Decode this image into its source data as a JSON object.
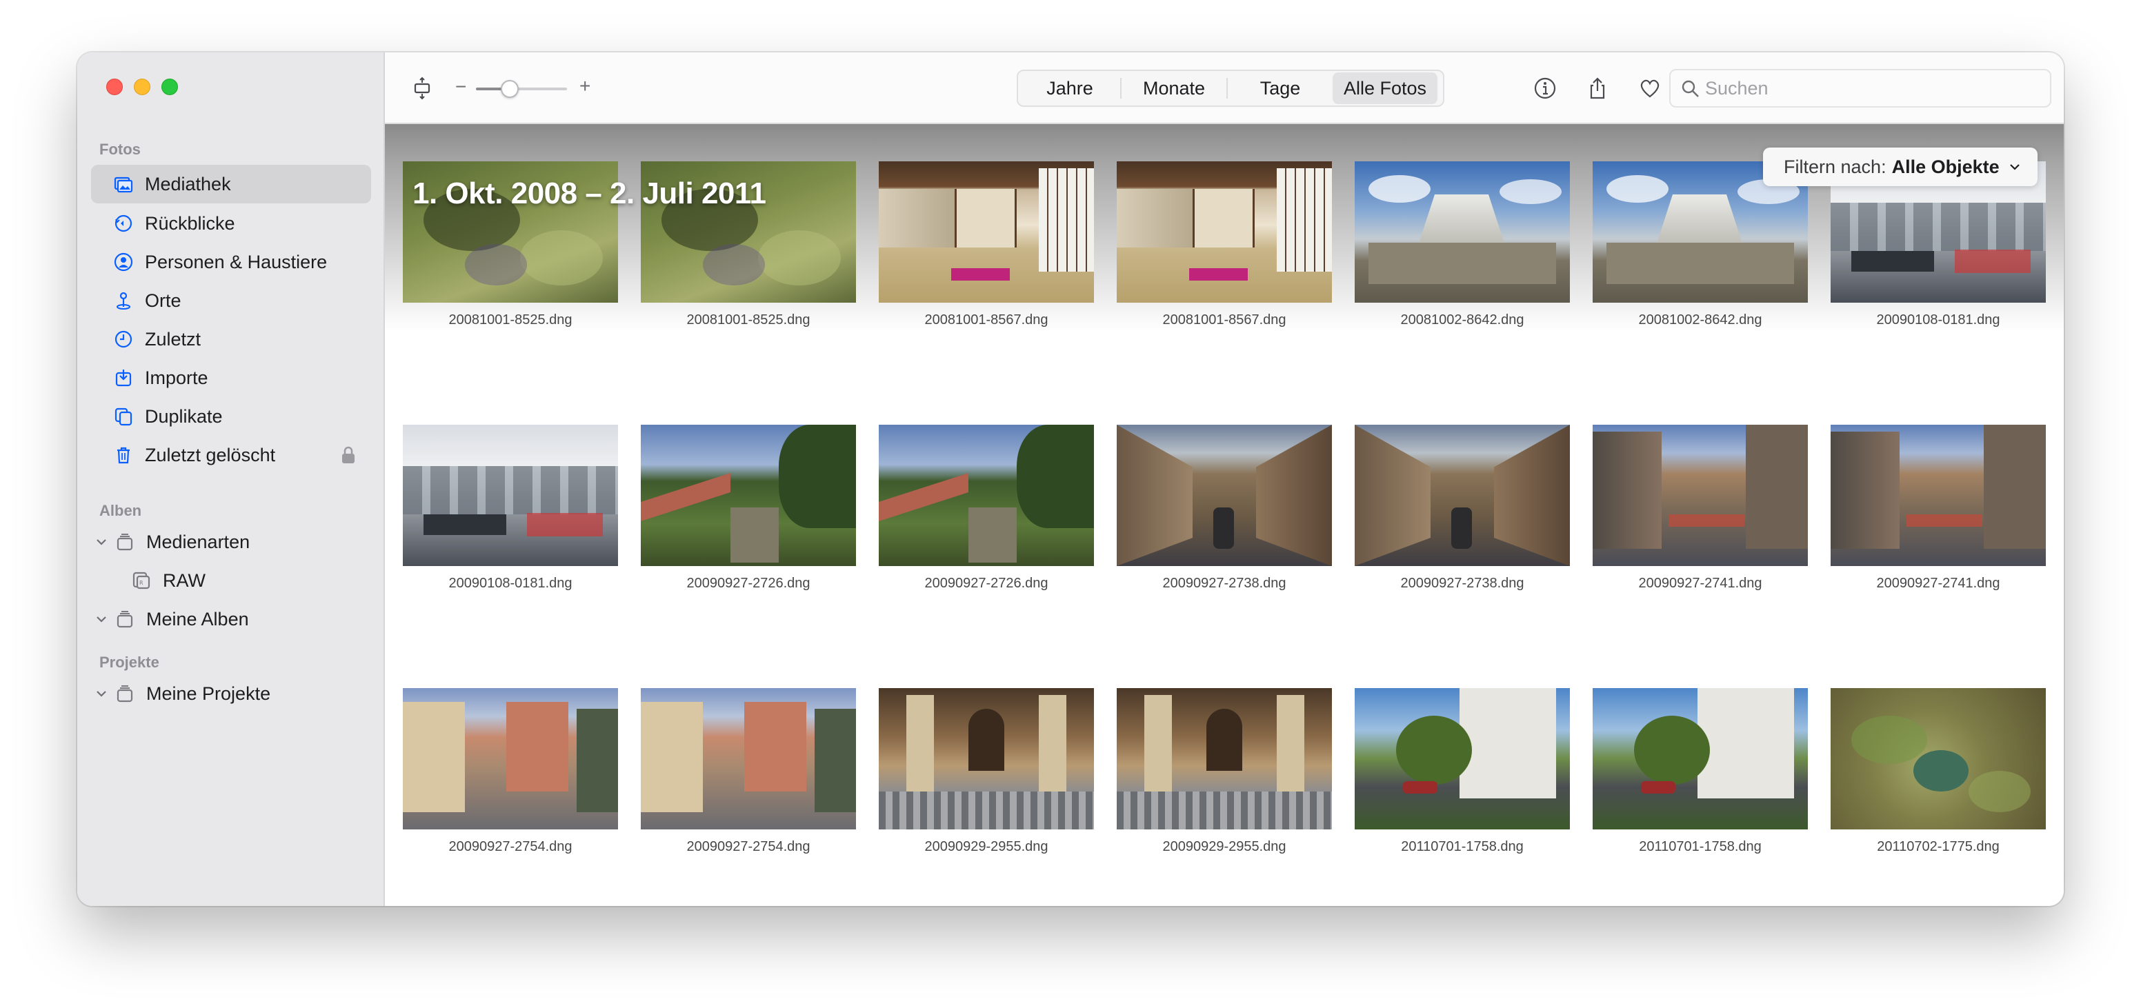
{
  "sidebar": {
    "sections": [
      {
        "label": "Fotos"
      },
      {
        "label": "Alben"
      },
      {
        "label": "Projekte"
      }
    ],
    "items": [
      {
        "label": "Mediathek",
        "icon": "library-icon",
        "selected": true
      },
      {
        "label": "Rückblicke",
        "icon": "memories-icon"
      },
      {
        "label": "Personen & Haustiere",
        "icon": "people-icon"
      },
      {
        "label": "Orte",
        "icon": "places-icon"
      },
      {
        "label": "Zuletzt",
        "icon": "recents-icon"
      },
      {
        "label": "Importe",
        "icon": "imports-icon"
      },
      {
        "label": "Duplikate",
        "icon": "duplicates-icon"
      },
      {
        "label": "Zuletzt gelöscht",
        "icon": "trash-icon",
        "locked": true
      },
      {
        "label": "Medienarten",
        "icon": "folder-stack-icon",
        "expanded": true
      },
      {
        "label": "RAW",
        "icon": "raw-icon"
      },
      {
        "label": "Meine Alben",
        "icon": "folder-stack-icon",
        "expanded": true
      },
      {
        "label": "Meine Projekte",
        "icon": "folder-stack-icon",
        "expanded": true
      }
    ]
  },
  "toolbar": {
    "zoom_minus": "−",
    "zoom_plus": "+",
    "zoom_level": 0.35,
    "segments": [
      "Jahre",
      "Monate",
      "Tage",
      "Alle Fotos"
    ],
    "active_segment": "Alle Fotos",
    "search_placeholder": "Suchen"
  },
  "content": {
    "date_range": "1. Okt. 2008 – 2. Juli 2011",
    "filter_label": "Filtern nach:",
    "filter_value": "Alle Objekte",
    "photos": [
      {
        "name": "20081001-8525.dng",
        "scene": "garden"
      },
      {
        "name": "20081001-8525.dng",
        "scene": "garden"
      },
      {
        "name": "20081001-8567.dng",
        "scene": "tatami"
      },
      {
        "name": "20081001-8567.dng",
        "scene": "tatami"
      },
      {
        "name": "20081002-8642.dng",
        "scene": "castle"
      },
      {
        "name": "20081002-8642.dng",
        "scene": "castle"
      },
      {
        "name": "20090108-0181.dng",
        "scene": "office"
      },
      {
        "name": "20090108-0181.dng",
        "scene": "office"
      },
      {
        "name": "20090927-2726.dng",
        "scene": "cloister"
      },
      {
        "name": "20090927-2726.dng",
        "scene": "cloister"
      },
      {
        "name": "20090927-2738.dng",
        "scene": "alley"
      },
      {
        "name": "20090927-2738.dng",
        "scene": "alley"
      },
      {
        "name": "20090927-2741.dng",
        "scene": "street"
      },
      {
        "name": "20090927-2741.dng",
        "scene": "street"
      },
      {
        "name": "20090927-2754.dng",
        "scene": "street2"
      },
      {
        "name": "20090927-2754.dng",
        "scene": "street2"
      },
      {
        "name": "20090929-2955.dng",
        "scene": "church"
      },
      {
        "name": "20090929-2955.dng",
        "scene": "church"
      },
      {
        "name": "20110701-1758.dng",
        "scene": "house"
      },
      {
        "name": "20110701-1758.dng",
        "scene": "house"
      },
      {
        "name": "20110702-1775.dng",
        "scene": "bird"
      }
    ]
  },
  "colors": {
    "accent": "#0a60ff",
    "sidebar_bg": "#e8e8ea",
    "close": "#ff5f57",
    "minimize": "#febc2e",
    "maximize": "#28c840"
  }
}
